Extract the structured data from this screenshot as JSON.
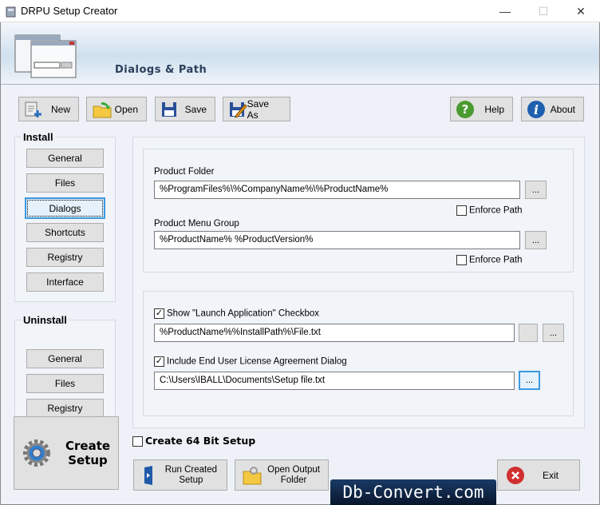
{
  "window": {
    "title": "DRPU Setup Creator",
    "minimize": "—",
    "maximize": "☐",
    "close": "✕"
  },
  "header": {
    "title": "Dialogs & Path"
  },
  "toolbar": {
    "new": "New",
    "open": "Open",
    "save": "Save",
    "save_as": "Save As",
    "help": "Help",
    "about": "About"
  },
  "install": {
    "label": "Install",
    "items": [
      "General",
      "Files",
      "Dialogs",
      "Shortcuts",
      "Registry",
      "Interface"
    ],
    "selected": "Dialogs"
  },
  "uninstall": {
    "label": "Uninstall",
    "items": [
      "General",
      "Files",
      "Registry"
    ]
  },
  "paths": {
    "product_folder_label": "Product Folder",
    "product_folder": "%ProgramFiles%\\%CompanyName%\\%ProductName%",
    "menu_group_label": "Product Menu Group",
    "menu_group": "%ProductName% %ProductVersion%",
    "enforce_path": "Enforce Path",
    "enforce1": false,
    "enforce2": false,
    "browse": "..."
  },
  "dialogs": {
    "launch_label": "Show \"Launch Application\" Checkbox",
    "launch_checked": true,
    "launch_path": "%ProductName%%InstallPath%\\File.txt",
    "eula_label": "Include End User License Agreement Dialog",
    "eula_checked": true,
    "eula_path": "C:\\Users\\IBALL\\Documents\\Setup file.txt"
  },
  "bottom": {
    "create_setup_1": "Create",
    "create_setup_2": "Setup",
    "create64": "Create 64 Bit Setup",
    "create64_checked": false,
    "run_1": "Run Created",
    "run_2": "Setup",
    "open_out_1": "Open Output",
    "open_out_2": "Folder",
    "exit": "Exit"
  },
  "watermark": "Db-Convert.com"
}
